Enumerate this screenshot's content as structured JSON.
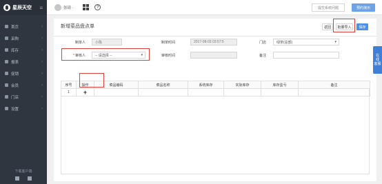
{
  "app": {
    "brand": "星辰天空",
    "user": "张硕 ·"
  },
  "sidebar": {
    "items": [
      {
        "label": "首页",
        "icon": "home-icon"
      },
      {
        "label": "采购",
        "icon": "cart-icon"
      },
      {
        "label": "库存",
        "icon": "box-icon"
      },
      {
        "label": "报表",
        "icon": "chart-icon"
      },
      {
        "label": "促销",
        "icon": "tag-icon"
      },
      {
        "label": "会员",
        "icon": "user-icon"
      },
      {
        "label": "门店",
        "icon": "store-icon"
      },
      {
        "label": "设置",
        "icon": "gear-icon"
      }
    ],
    "footer_text": "下载客户端"
  },
  "topbar": {
    "feedback_label": "提交系统问题",
    "order_label": "预约演示"
  },
  "page": {
    "title": "新增菜品盘点单",
    "back_label": "返回",
    "import_label": "批量导入",
    "save_label": "保存"
  },
  "form": {
    "maker_label": "制单人",
    "maker_value": "小陈",
    "make_time_label": "制单时间",
    "make_time_value": "2017-08-03 03:57:5",
    "store_label": "门店",
    "store_value": "绿茶(总部)",
    "auditor_label": "审核人",
    "auditor_placeholder": "-- 请选择 --",
    "audit_time_label": "审核时间",
    "audit_time_value": "",
    "remark_label": "备注",
    "remark_value": ""
  },
  "table": {
    "columns": [
      "序号",
      "操作",
      "菜品编码",
      "菜品名称",
      "系统库存",
      "实际库存",
      "库存盈亏",
      "备注"
    ],
    "rows": [
      {
        "index": "1",
        "action": "+"
      }
    ]
  },
  "side_tab": {
    "line1": "在",
    "line2": "线",
    "line3": "客服"
  },
  "colors": {
    "sidebar_bg": "#2f3640",
    "primary": "#4d90e6",
    "highlight": "#e0403a"
  }
}
